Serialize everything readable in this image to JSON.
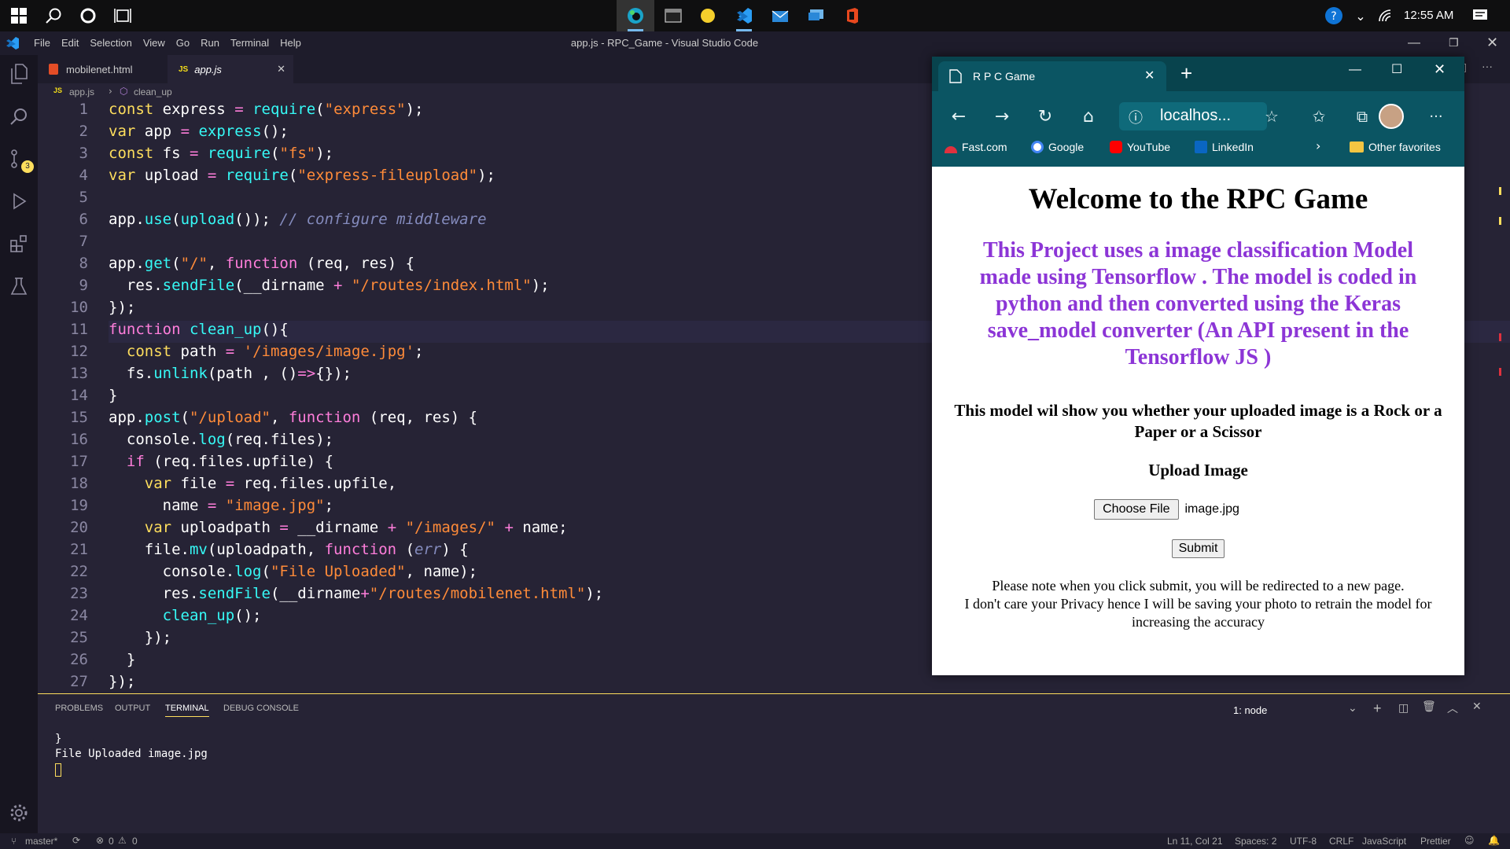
{
  "taskbar": {
    "time": "12:55 AM"
  },
  "vscode": {
    "title": "app.js - RPC_Game - Visual Studio Code",
    "menu": [
      "File",
      "Edit",
      "Selection",
      "View",
      "Go",
      "Run",
      "Terminal",
      "Help"
    ],
    "tabs": [
      {
        "label": "mobilenet.html",
        "icon": "html-file-icon"
      },
      {
        "label": "app.js",
        "icon": "js-file-icon",
        "active": true
      }
    ],
    "breadcrumb": {
      "file": "app.js",
      "symbol": "clean_up",
      "js_badge": "JS"
    },
    "scm_badge": "3",
    "lines": [
      {
        "n": "1",
        "html": "<span class='k'>const</span> <span class='w'>express</span> <span class='v'>=</span> <span class='f'>require</span>(<span class='s'>\"express\"</span>);"
      },
      {
        "n": "2",
        "html": "<span class='k'>var</span> <span class='w'>app</span> <span class='v'>=</span> <span class='f'>express</span>();"
      },
      {
        "n": "3",
        "html": "<span class='k'>const</span> <span class='w'>fs</span> <span class='v'>=</span> <span class='f'>require</span>(<span class='s'>\"fs\"</span>);"
      },
      {
        "n": "4",
        "html": "<span class='k'>var</span> <span class='w'>upload</span> <span class='v'>=</span> <span class='f'>require</span>(<span class='s'>\"express-fileupload\"</span>);"
      },
      {
        "n": "5",
        "html": ""
      },
      {
        "n": "6",
        "html": "<span class='w'>app</span>.<span class='f'>use</span>(<span class='f'>upload</span>()); <span class='c'>// configure middleware</span>"
      },
      {
        "n": "7",
        "html": ""
      },
      {
        "n": "8",
        "html": "<span class='w'>app</span>.<span class='f'>get</span>(<span class='s'>\"/\"</span>, <span class='v'>function</span> (<span class='w'>req</span>, <span class='w'>res</span>) {"
      },
      {
        "n": "9",
        "html": "  <span class='w'>res</span>.<span class='f'>sendFile</span>(<span class='w'>__dirname</span> <span class='v'>+</span> <span class='s'>\"/routes/index.html\"</span>);"
      },
      {
        "n": "10",
        "html": "});"
      },
      {
        "n": "11",
        "html": "<span class='v'>function</span> <span class='f'>clean_up</span>(){"
      },
      {
        "n": "12",
        "html": "  <span class='k'>const</span> <span class='w'>path</span> <span class='v'>=</span> <span class='s'>'/images/image.jpg'</span>;"
      },
      {
        "n": "13",
        "html": "  <span class='w'>fs</span>.<span class='f'>unlink</span>(<span class='w'>path</span> , ()<span class='v'>=&gt;</span>{});"
      },
      {
        "n": "14",
        "html": "}"
      },
      {
        "n": "15",
        "html": "<span class='w'>app</span>.<span class='f'>post</span>(<span class='s'>\"/upload\"</span>, <span class='v'>function</span> (<span class='w'>req</span>, <span class='w'>res</span>) {"
      },
      {
        "n": "16",
        "html": "  <span class='w'>console</span>.<span class='f'>log</span>(<span class='w'>req</span>.<span class='w'>files</span>);"
      },
      {
        "n": "17",
        "html": "  <span class='v'>if</span> (<span class='w'>req</span>.<span class='w'>files</span>.<span class='w'>upfile</span>) {"
      },
      {
        "n": "18",
        "html": "    <span class='k'>var</span> <span class='w'>file</span> <span class='v'>=</span> <span class='w'>req</span>.<span class='w'>files</span>.<span class='w'>upfile</span>,"
      },
      {
        "n": "19",
        "html": "      <span class='w'>name</span> <span class='v'>=</span> <span class='s'>\"image.jpg\"</span>;"
      },
      {
        "n": "20",
        "html": "    <span class='k'>var</span> <span class='w'>uploadpath</span> <span class='v'>=</span> <span class='w'>__dirname</span> <span class='v'>+</span> <span class='s'>\"/images/\"</span> <span class='v'>+</span> <span class='w'>name</span>;"
      },
      {
        "n": "21",
        "html": "    <span class='w'>file</span>.<span class='f'>mv</span>(<span class='w'>uploadpath</span>, <span class='v'>function</span> (<span class='c'>err</span>) {"
      },
      {
        "n": "22",
        "html": "      <span class='w'>console</span>.<span class='f'>log</span>(<span class='s'>\"File Uploaded\"</span>, <span class='w'>name</span>);"
      },
      {
        "n": "23",
        "html": "      <span class='w'>res</span>.<span class='f'>sendFile</span>(<span class='w'>__dirname</span><span class='v'>+</span><span class='s'>\"/routes/mobilenet.html\"</span>);"
      },
      {
        "n": "24",
        "html": "      <span class='f'>clean_up</span>();"
      },
      {
        "n": "25",
        "html": "    });"
      },
      {
        "n": "26",
        "html": "  }"
      },
      {
        "n": "27",
        "html": "});"
      }
    ],
    "panel": {
      "tabs": [
        "PROBLEMS",
        "OUTPUT",
        "TERMINAL",
        "DEBUG CONSOLE"
      ],
      "terminal_select": "1: node",
      "output": [
        "}",
        "File Uploaded image.jpg"
      ]
    },
    "status": {
      "branch": "master*",
      "errors": "0",
      "warnings": "0",
      "position": "Ln 11, Col 21",
      "spaces": "Spaces: 2",
      "encoding": "UTF-8",
      "eol": "CRLF",
      "language": "JavaScript",
      "formatter": "Prettier"
    }
  },
  "browser": {
    "tab_title": "R P C Game",
    "url": "localhos...",
    "favorites": [
      "Fast.com",
      "Google",
      "YouTube",
      "LinkedIn"
    ],
    "other_favorites": "Other favorites",
    "page": {
      "heading": "Welcome to the RPC Game",
      "description": "This Project uses a image classification Model made using Tensorflow . The model is coded in python and then converted using the Keras save_model converter (An API present in the Tensorflow JS )",
      "subheading": "This model wil show you whether your uploaded image is a Rock or a Paper or a Scissor",
      "upload_title": "Upload Image",
      "choose_file": "Choose File",
      "file_name": "image.jpg",
      "submit": "Submit",
      "note1": "Please note when you click submit, you will be redirected to a new page.",
      "note2": "I don't care your Privacy hence I will be saving your photo to retrain the model for increasing the accuracy"
    }
  }
}
